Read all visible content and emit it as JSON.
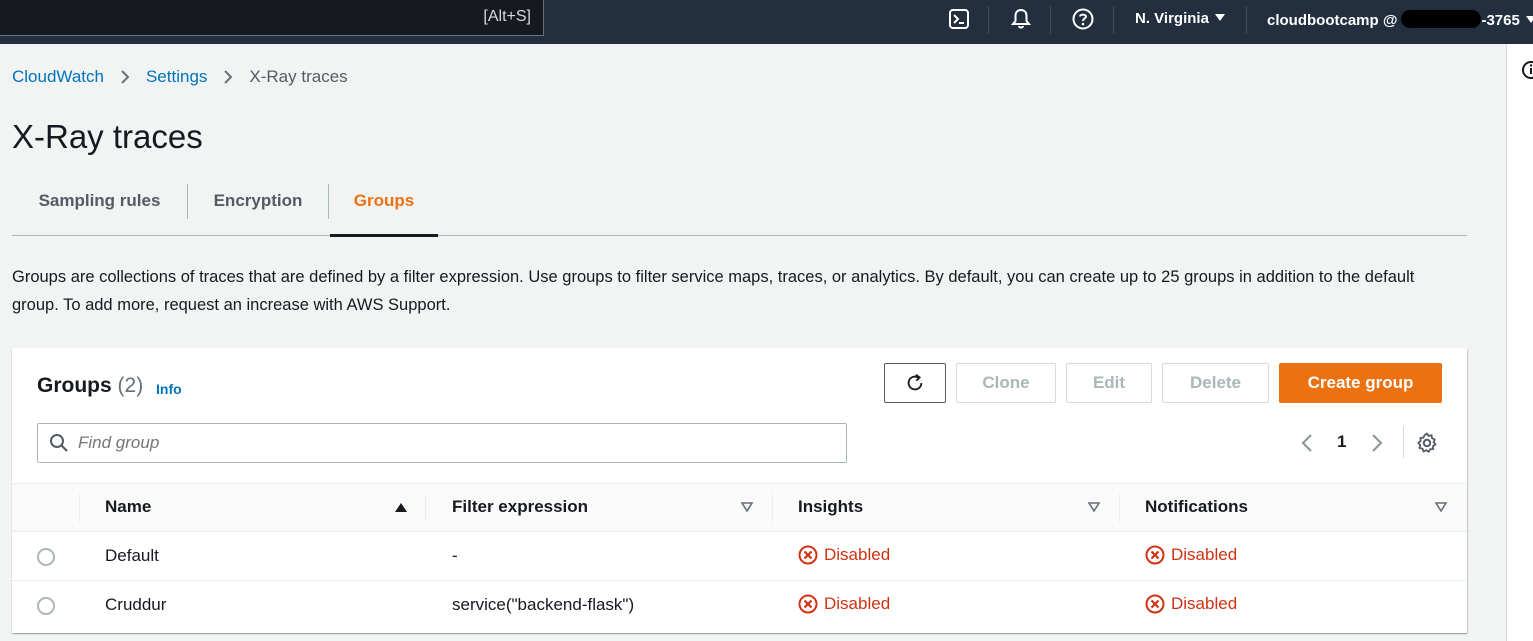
{
  "topnav": {
    "search_shortcut": "[Alt+S]",
    "region": "N. Virginia",
    "account_prefix": "cloudbootcamp @",
    "account_suffix": "-3765"
  },
  "breadcrumb": {
    "items": [
      "CloudWatch",
      "Settings"
    ],
    "current": "X-Ray traces"
  },
  "page_title": "X-Ray traces",
  "tabs": [
    {
      "label": "Sampling rules",
      "active": false
    },
    {
      "label": "Encryption",
      "active": false
    },
    {
      "label": "Groups",
      "active": true
    }
  ],
  "description": "Groups are collections of traces that are defined by a filter expression. Use groups to filter service maps, traces, or analytics. By default, you can create up to 25 groups in addition to the default group. To add more, request an increase with AWS Support.",
  "panel": {
    "title": "Groups",
    "count": "(2)",
    "info": "Info",
    "buttons": {
      "clone": "Clone",
      "edit": "Edit",
      "delete": "Delete",
      "create": "Create group"
    },
    "search_placeholder": "Find group",
    "page": "1"
  },
  "table": {
    "columns": [
      "Name",
      "Filter expression",
      "Insights",
      "Notifications"
    ],
    "sort_column": "Name",
    "rows": [
      {
        "name": "Default",
        "filter": "-",
        "insights": "Disabled",
        "notifications": "Disabled"
      },
      {
        "name": "Cruddur",
        "filter": "service(\"backend-flask\")",
        "insights": "Disabled",
        "notifications": "Disabled"
      }
    ]
  },
  "colors": {
    "accent": "#ec7211",
    "link": "#0073bb",
    "error": "#d13212",
    "nav_bg": "#232f3e"
  }
}
